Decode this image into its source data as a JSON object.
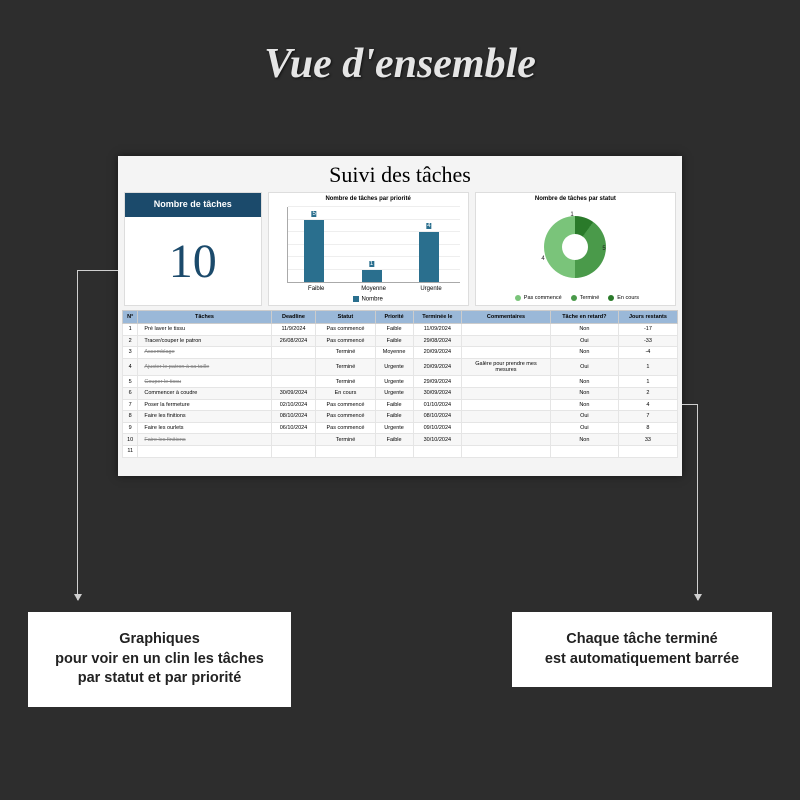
{
  "page_title": "Vue d'ensemble",
  "dashboard": {
    "title": "Suivi des tâches",
    "count_panel": {
      "label": "Nombre de tâches",
      "value": "10"
    },
    "bar_chart": {
      "title": "Nombre de tâches par priorité",
      "legend": "Nombre",
      "categories": [
        "Faible",
        "Moyenne",
        "Urgente"
      ],
      "values": [
        5,
        1,
        4
      ]
    },
    "donut_chart": {
      "title": "Nombre de tâches par statut",
      "series": [
        {
          "name": "Pas commencé",
          "value": 5,
          "color": "#7ac47a"
        },
        {
          "name": "Terminé",
          "value": 4,
          "color": "#4a9a4a"
        },
        {
          "name": "En cours",
          "value": 1,
          "color": "#2a7a2a"
        }
      ],
      "labels": {
        "a": "1",
        "b": "5",
        "c": "4"
      }
    },
    "table": {
      "headers": [
        "N°",
        "Tâches",
        "Deadline",
        "Statut",
        "Priorité",
        "Terminée le",
        "Commentaires",
        "Tâche en retard?",
        "Jours restants"
      ],
      "rows": [
        {
          "n": "1",
          "t": "Pré laver le tissu",
          "d": "11/9/2024",
          "s": "Pas commencé",
          "p": "Faible",
          "f": "11/09/2024",
          "c": "",
          "r": "Non",
          "j": "-17",
          "strike": false
        },
        {
          "n": "2",
          "t": "Tracer/couper le patron",
          "d": "26/08/2024",
          "s": "Pas commencé",
          "p": "Faible",
          "f": "29/08/2024",
          "c": "",
          "r": "Oui",
          "j": "-33",
          "strike": false
        },
        {
          "n": "3",
          "t": "Assemblage",
          "d": "",
          "s": "Terminé",
          "p": "Moyenne",
          "f": "20/09/2024",
          "c": "",
          "r": "Non",
          "j": "-4",
          "strike": true
        },
        {
          "n": "4",
          "t": "Ajuster le patron à sa taille",
          "d": "",
          "s": "Terminé",
          "p": "Urgente",
          "f": "20/09/2024",
          "c": "Galère pour prendre mes mesures",
          "r": "Oui",
          "j": "1",
          "strike": true
        },
        {
          "n": "5",
          "t": "Couper le tissu",
          "d": "",
          "s": "Terminé",
          "p": "Urgente",
          "f": "29/09/2024",
          "c": "",
          "r": "Non",
          "j": "1",
          "strike": true
        },
        {
          "n": "6",
          "t": "Commencer à coudre",
          "d": "30/09/2024",
          "s": "En cours",
          "p": "Urgente",
          "f": "30/09/2024",
          "c": "",
          "r": "Non",
          "j": "2",
          "strike": false
        },
        {
          "n": "7",
          "t": "Poser la fermeture",
          "d": "02/10/2024",
          "s": "Pas commencé",
          "p": "Faible",
          "f": "01/10/2024",
          "c": "",
          "r": "Non",
          "j": "4",
          "strike": false
        },
        {
          "n": "8",
          "t": "Faire les finitions",
          "d": "08/10/2024",
          "s": "Pas commencé",
          "p": "Faible",
          "f": "08/10/2024",
          "c": "",
          "r": "Oui",
          "j": "7",
          "strike": false
        },
        {
          "n": "9",
          "t": "Faire les ourlets",
          "d": "06/10/2024",
          "s": "Pas commencé",
          "p": "Urgente",
          "f": "09/10/2024",
          "c": "",
          "r": "Oui",
          "j": "8",
          "strike": false
        },
        {
          "n": "10",
          "t": "Faire les finitions",
          "d": "",
          "s": "Terminé",
          "p": "Faible",
          "f": "30/10/2024",
          "c": "",
          "r": "Non",
          "j": "33",
          "strike": true
        },
        {
          "n": "11",
          "t": "",
          "d": "",
          "s": "",
          "p": "",
          "f": "",
          "c": "",
          "r": "",
          "j": "",
          "strike": false
        }
      ]
    }
  },
  "callouts": {
    "left_l1": "Graphiques",
    "left_l2": "pour voir en un clin les tâches",
    "left_l3": "par statut et par priorité",
    "right_l1": "Chaque tâche terminé",
    "right_l2": "est automatiquement barrée"
  },
  "chart_data": [
    {
      "type": "bar",
      "title": "Nombre de tâches par priorité",
      "categories": [
        "Faible",
        "Moyenne",
        "Urgente"
      ],
      "series": [
        {
          "name": "Nombre",
          "values": [
            5,
            1,
            4
          ]
        }
      ],
      "ylim": [
        0,
        6
      ]
    },
    {
      "type": "pie",
      "title": "Nombre de tâches par statut",
      "categories": [
        "Pas commencé",
        "Terminé",
        "En cours"
      ],
      "values": [
        5,
        4,
        1
      ]
    }
  ]
}
